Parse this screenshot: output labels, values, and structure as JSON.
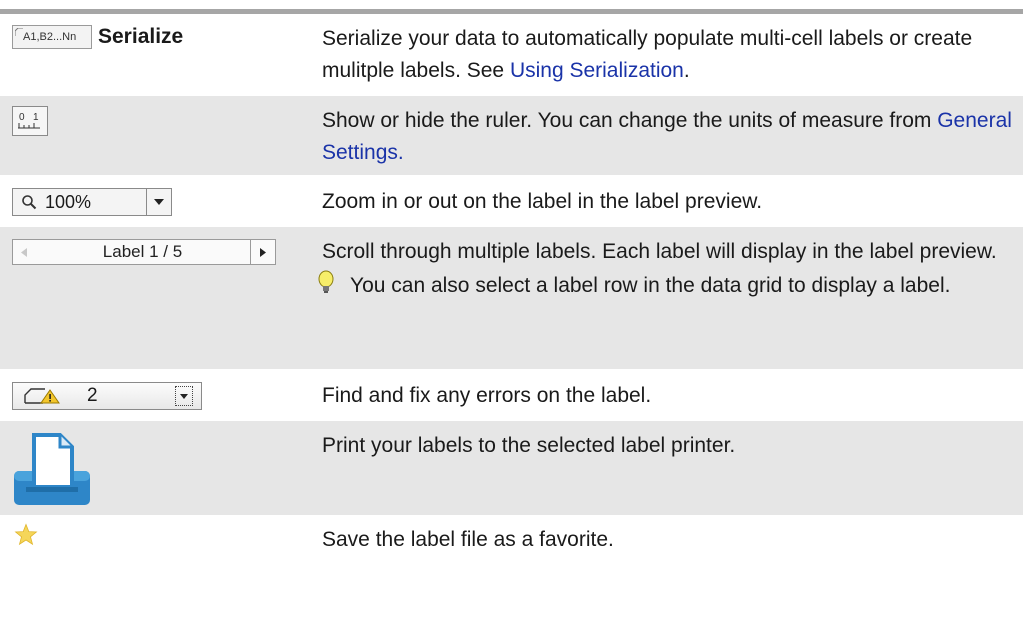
{
  "rows": [
    {
      "icon_name": "serialize-icon",
      "icon_text": "A1,B2...Nn",
      "label": "Serialize",
      "desc_1": "Serialize your data to automatically populate multi-cell labels or create mulitple labels. See ",
      "link": "Using Serialization",
      "desc_2": "."
    },
    {
      "icon_name": "ruler-icon",
      "desc_1": "Show or hide the ruler. You can change the units of measure from ",
      "link": "General Settings."
    },
    {
      "icon_name": "zoom-control",
      "zoom_value": "100%",
      "desc": "Zoom in or out on the label in the label preview."
    },
    {
      "icon_name": "label-pager",
      "pager_text": "Label 1 / 5",
      "desc": "Scroll through multiple labels. Each label will display in the label preview.",
      "tip": "You can also select a label row in the data grid to display a label."
    },
    {
      "icon_name": "error-indicator",
      "error_count": "2",
      "desc": "Find and fix any errors on the label."
    },
    {
      "icon_name": "print-icon",
      "desc": "Print your labels to the selected label printer."
    },
    {
      "icon_name": "star-icon",
      "desc": "Save the label file as a favorite."
    }
  ],
  "colors": {
    "link": "#1a33a8",
    "row_shade": "#e6e6e6",
    "top_rule": "#a6a6a6",
    "print_blue": "#2e86c8",
    "star_yellow": "#f5d65a"
  }
}
